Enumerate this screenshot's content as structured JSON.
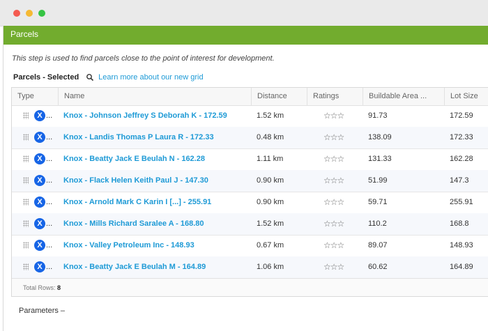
{
  "panel": {
    "title": "Parcels",
    "description": "This step is used to find parcels close to the point of interest for development."
  },
  "toolbar": {
    "label": "Parcels - Selected",
    "search_icon": "search-icon",
    "link": "Learn more about our new grid"
  },
  "grid": {
    "columns": [
      "Type",
      "Name",
      "Distance",
      "Ratings",
      "Buildable Area ...",
      "Lot Size"
    ],
    "rows": [
      {
        "type": "X",
        "ellipsis": "...",
        "name": "Knox - Johnson Jeffrey S Deborah K - 172.59",
        "distance": "1.52 km",
        "ratings": "☆☆☆",
        "buildable": "91.73",
        "lot": "172.59"
      },
      {
        "type": "X",
        "ellipsis": "...",
        "name": "Knox - Landis Thomas P Laura R - 172.33",
        "distance": "0.48 km",
        "ratings": "☆☆☆",
        "buildable": "138.09",
        "lot": "172.33"
      },
      {
        "type": "X",
        "ellipsis": "...",
        "name": "Knox - Beatty Jack E Beulah N - 162.28",
        "distance": "1.11 km",
        "ratings": "☆☆☆",
        "buildable": "131.33",
        "lot": "162.28"
      },
      {
        "type": "X",
        "ellipsis": "...",
        "name": "Knox - Flack Helen Keith Paul J - 147.30",
        "distance": "0.90 km",
        "ratings": "☆☆☆",
        "buildable": "51.99",
        "lot": "147.3"
      },
      {
        "type": "X",
        "ellipsis": "...",
        "name": "Knox - Arnold Mark C Karin I [...] - 255.91",
        "distance": "0.90 km",
        "ratings": "☆☆☆",
        "buildable": "59.71",
        "lot": "255.91"
      },
      {
        "type": "X",
        "ellipsis": "...",
        "name": "Knox - Mills Richard Saralee A - 168.80",
        "distance": "1.52 km",
        "ratings": "☆☆☆",
        "buildable": "110.2",
        "lot": "168.8"
      },
      {
        "type": "X",
        "ellipsis": "...",
        "name": "Knox - Valley Petroleum Inc - 148.93",
        "distance": "0.67 km",
        "ratings": "☆☆☆",
        "buildable": "89.07",
        "lot": "148.93"
      },
      {
        "type": "X",
        "ellipsis": "...",
        "name": "Knox - Beatty Jack E Beulah M - 164.89",
        "distance": "1.06 km",
        "ratings": "☆☆☆",
        "buildable": "60.62",
        "lot": "164.89"
      }
    ],
    "footer_label": "Total Rows:",
    "footer_count": "8"
  },
  "parameters": {
    "label": "Parameters",
    "toggle": "–"
  },
  "colors": {
    "header_green": "#72ac2e",
    "link_blue": "#1e9ad6",
    "type_icon_blue": "#1765e6"
  }
}
